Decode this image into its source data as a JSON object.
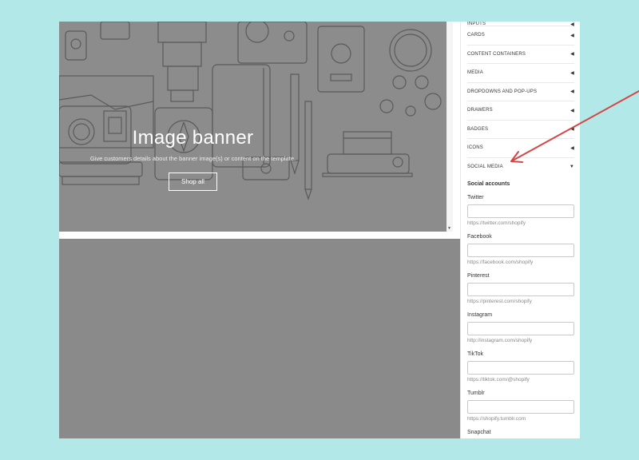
{
  "banner": {
    "title": "Image banner",
    "description": "Give customers details about the banner image(s) or content on the template.",
    "button_label": "Shop all"
  },
  "settings": {
    "sections": [
      {
        "label": "INPUTS",
        "icon": "caret-left-icon",
        "expanded": false
      },
      {
        "label": "CARDS",
        "icon": "caret-left-icon",
        "expanded": false
      },
      {
        "label": "CONTENT CONTAINERS",
        "icon": "caret-left-icon",
        "expanded": false
      },
      {
        "label": "MEDIA",
        "icon": "caret-left-icon",
        "expanded": false
      },
      {
        "label": "DROPDOWNS AND POP-UPS",
        "icon": "caret-left-icon",
        "expanded": false
      },
      {
        "label": "DRAWERS",
        "icon": "caret-left-icon",
        "expanded": false
      },
      {
        "label": "BADGES",
        "icon": "caret-left-icon",
        "expanded": false
      },
      {
        "label": "ICONS",
        "icon": "caret-left-icon",
        "expanded": false
      },
      {
        "label": "SOCIAL MEDIA",
        "icon": "caret-down-icon",
        "expanded": true
      }
    ],
    "social_heading": "Social accounts",
    "fields": [
      {
        "label": "Twitter",
        "value": "",
        "hint": "https://twitter.com/shopify"
      },
      {
        "label": "Facebook",
        "value": "",
        "hint": "https://facebook.com/shopify"
      },
      {
        "label": "Pinterest",
        "value": "",
        "hint": "https://pinterest.com/shopify"
      },
      {
        "label": "Instagram",
        "value": "",
        "hint": "http://instagram.com/shopify"
      },
      {
        "label": "TikTok",
        "value": "",
        "hint": "https://tiktok.com/@shopify"
      },
      {
        "label": "Tumblr",
        "value": "",
        "hint": "https://shopify.tumblr.com"
      },
      {
        "label": "Snapchat",
        "value": "",
        "hint": ""
      }
    ]
  },
  "colors": {
    "background": "#b3e8e8",
    "banner_overlay": "#8c8c8c",
    "annotation_arrow": "#d64545"
  }
}
